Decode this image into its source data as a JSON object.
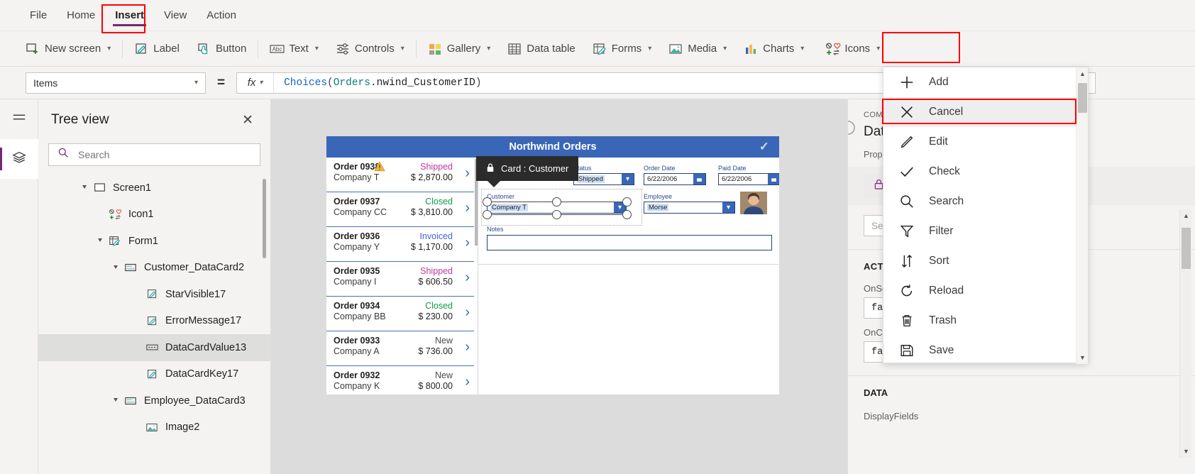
{
  "menubar": {
    "items": [
      {
        "label": "File",
        "active": false
      },
      {
        "label": "Home",
        "active": false
      },
      {
        "label": "Insert",
        "active": true
      },
      {
        "label": "View",
        "active": false
      },
      {
        "label": "Action",
        "active": false
      }
    ]
  },
  "ribbon": {
    "items": [
      {
        "label": "New screen",
        "icon": "new-screen-icon",
        "caret": true
      },
      {
        "label": "Label",
        "icon": "label-icon",
        "caret": false
      },
      {
        "label": "Button",
        "icon": "button-icon",
        "caret": false
      },
      {
        "label": "Text",
        "icon": "text-icon",
        "caret": true
      },
      {
        "label": "Controls",
        "icon": "controls-icon",
        "caret": true
      },
      {
        "label": "Gallery",
        "icon": "gallery-icon",
        "caret": true
      },
      {
        "label": "Data table",
        "icon": "data-table-icon",
        "caret": false
      },
      {
        "label": "Forms",
        "icon": "forms-icon",
        "caret": true
      },
      {
        "label": "Media",
        "icon": "media-icon",
        "caret": true
      },
      {
        "label": "Charts",
        "icon": "charts-icon",
        "caret": true
      },
      {
        "label": "Icons",
        "icon": "icons-icon",
        "caret": true
      }
    ]
  },
  "formula_bar": {
    "property_selected": "Items",
    "equals": "=",
    "fx_label": "fx",
    "formula_tokens": [
      {
        "t": "Choices",
        "c": "fn"
      },
      {
        "t": "(",
        "c": "pn"
      },
      {
        "t": "Orders",
        "c": "tbl"
      },
      {
        "t": ".",
        "c": "fld"
      },
      {
        "t": "nwind_CustomerID",
        "c": "fld"
      },
      {
        "t": ")",
        "c": "pn"
      }
    ],
    "formula_plain": "Choices(Orders.nwind_CustomerID)"
  },
  "tree_view": {
    "title": "Tree view",
    "close_label": "✕",
    "search_placeholder": "Search",
    "search_value": "",
    "nodes": [
      {
        "label": "Screen1",
        "depth": 0,
        "icon": "screen-icon",
        "twisty": "expanded",
        "selected": false
      },
      {
        "label": "Icon1",
        "depth": 1,
        "icon": "icons-icon",
        "twisty": "none",
        "selected": false
      },
      {
        "label": "Form1",
        "depth": 1,
        "icon": "form-icon",
        "twisty": "expanded",
        "selected": false
      },
      {
        "label": "Customer_DataCard2",
        "depth": 2,
        "icon": "datacard-icon",
        "twisty": "expanded",
        "selected": false
      },
      {
        "label": "StarVisible17",
        "depth": 3,
        "icon": "label-icon",
        "twisty": "none",
        "selected": false
      },
      {
        "label": "ErrorMessage17",
        "depth": 3,
        "icon": "label-icon",
        "twisty": "none",
        "selected": false
      },
      {
        "label": "DataCardValue13",
        "depth": 3,
        "icon": "combobox-icon",
        "twisty": "none",
        "selected": true
      },
      {
        "label": "DataCardKey17",
        "depth": 3,
        "icon": "label-icon",
        "twisty": "none",
        "selected": false
      },
      {
        "label": "Employee_DataCard3",
        "depth": 2,
        "icon": "datacard-icon",
        "twisty": "expanded",
        "selected": false
      },
      {
        "label": "Image2",
        "depth": 3,
        "icon": "image-icon",
        "twisty": "none",
        "selected": false
      }
    ]
  },
  "canvas": {
    "app_title": "Northwind Orders",
    "tooltip": {
      "label": "Card : Customer",
      "icon": "lock-icon"
    },
    "gallery": [
      {
        "order": "Order 0938",
        "company": "Company T",
        "status": "Shipped",
        "status_color": "#c0399f",
        "amount": "$ 2,870.00",
        "warning": true
      },
      {
        "order": "Order 0937",
        "company": "Company CC",
        "status": "Closed",
        "status_color": "#0e9c4a",
        "amount": "$ 3,810.00",
        "warning": false
      },
      {
        "order": "Order 0936",
        "company": "Company Y",
        "status": "Invoiced",
        "status_color": "#4a5fd4",
        "amount": "$ 1,170.00",
        "warning": false
      },
      {
        "order": "Order 0935",
        "company": "Company I",
        "status": "Shipped",
        "status_color": "#c0399f",
        "amount": "$ 606.50",
        "warning": false
      },
      {
        "order": "Order 0934",
        "company": "Company BB",
        "status": "Closed",
        "status_color": "#0e9c4a",
        "amount": "$ 230.00",
        "warning": false
      },
      {
        "order": "Order 0933",
        "company": "Company A",
        "status": "New",
        "status_color": "#4a4a4a",
        "amount": "$ 736.00",
        "warning": false
      },
      {
        "order": "Order 0932",
        "company": "Company K",
        "status": "New",
        "status_color": "#4a4a4a",
        "amount": "$ 800.00",
        "warning": false
      }
    ],
    "form_fields": {
      "status": {
        "label": "Status",
        "value": "Shipped"
      },
      "order_date": {
        "label": "Order Date",
        "value": "6/22/2006"
      },
      "paid_date": {
        "label": "Paid Date",
        "value": "6/22/2006"
      },
      "customer": {
        "label": "Customer",
        "value": "Company T"
      },
      "employee": {
        "label": "Employee",
        "value": "Morse"
      },
      "notes": {
        "label": "Notes",
        "value": ""
      }
    }
  },
  "icon_menu": {
    "items": [
      {
        "label": "Add",
        "icon": "plus-icon",
        "highlighted": false
      },
      {
        "label": "Cancel",
        "icon": "cancel-x-icon",
        "highlighted": true
      },
      {
        "label": "Edit",
        "icon": "pencil-icon",
        "highlighted": false
      },
      {
        "label": "Check",
        "icon": "check-icon",
        "highlighted": false
      },
      {
        "label": "Search",
        "icon": "magnifier-icon",
        "highlighted": false
      },
      {
        "label": "Filter",
        "icon": "funnel-icon",
        "highlighted": false
      },
      {
        "label": "Sort",
        "icon": "sort-arrows-icon",
        "highlighted": false
      },
      {
        "label": "Reload",
        "icon": "reload-icon",
        "highlighted": false
      },
      {
        "label": "Trash",
        "icon": "trash-icon",
        "highlighted": false
      },
      {
        "label": "Save",
        "icon": "floppy-save-icon",
        "highlighted": false
      }
    ],
    "scroll_up": "▲",
    "scroll_down": "▼"
  },
  "properties_panel": {
    "control_type": "COMBOBOX",
    "control_name": "Data",
    "properties_label": "Prope",
    "lock_icon": "lock-icon",
    "search_placeholder": "Sea",
    "sections": [
      {
        "heading": "ACTIO"
      },
      {
        "heading": "DATA"
      }
    ],
    "fields": [
      {
        "label": "OnSe",
        "value": "fal"
      },
      {
        "label": "OnCh",
        "value": "false"
      }
    ],
    "data_section_heading": "DATA",
    "data_fields": [
      {
        "label": "DisplayFields"
      }
    ],
    "scroll_up": "▲",
    "scroll_down": "▼"
  },
  "colors": {
    "accent_purple": "#742774",
    "app_blue": "#3a66b7",
    "highlight_red": "#ff0000",
    "chrome_grey": "#f4f3f2"
  }
}
